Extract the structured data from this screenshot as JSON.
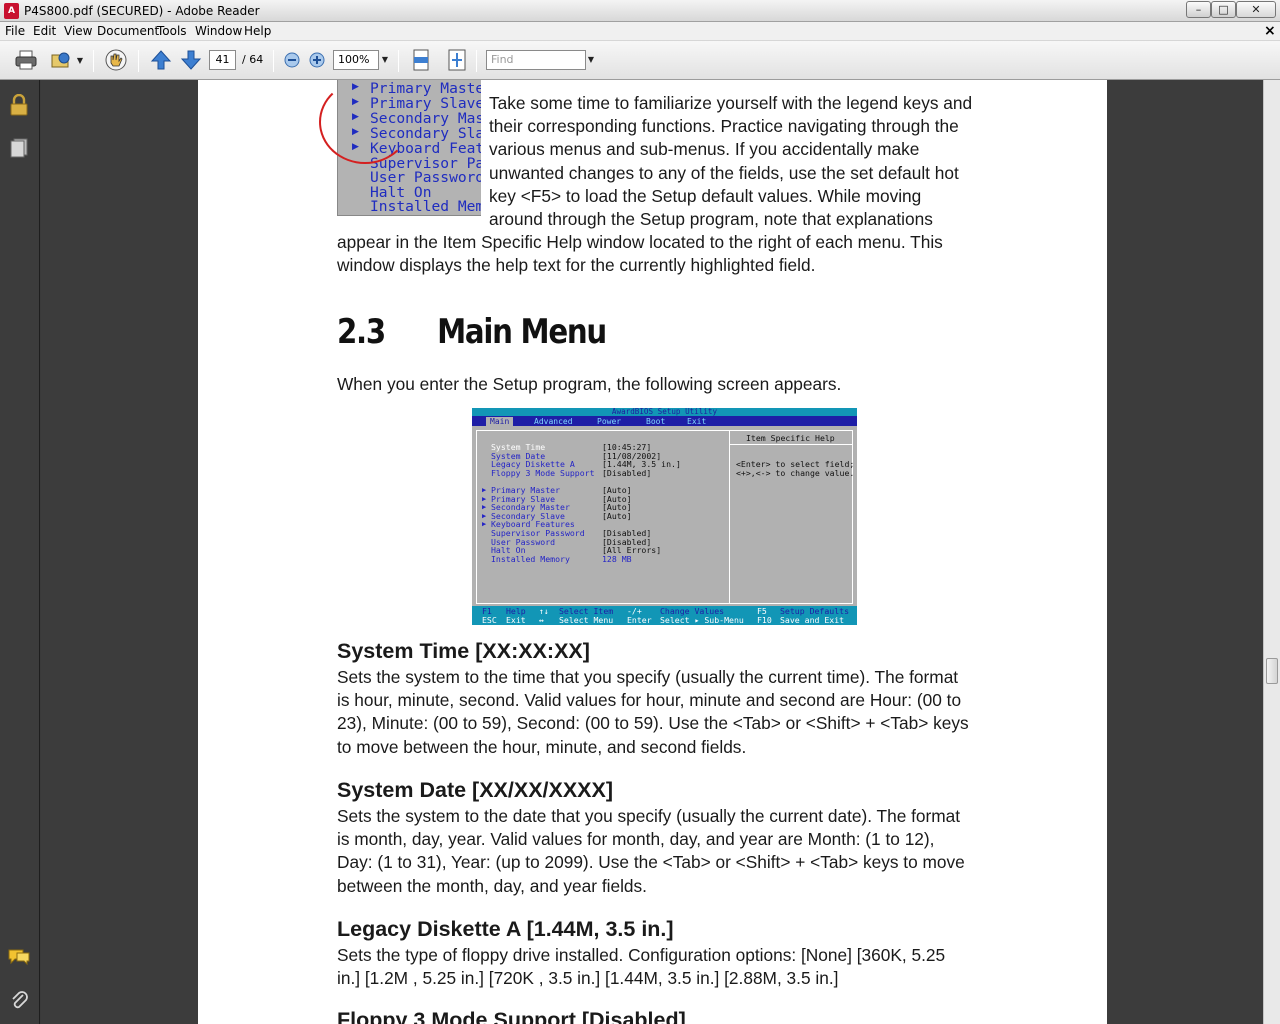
{
  "window": {
    "title": "P4S800.pdf (SECURED) - Adobe Reader",
    "app_icon": "A",
    "min": "–",
    "max": "□",
    "close": "✕"
  },
  "menubar": {
    "items": [
      "File",
      "Edit",
      "View",
      "Document",
      "Tools",
      "Window",
      "Help"
    ],
    "doc_close": "×"
  },
  "toolbar": {
    "page_current": "41",
    "page_total": "/ 64",
    "zoom": "100%",
    "find_placeholder": "Find"
  },
  "document": {
    "intro_paragraph_lines": [
      "Take some time to familiarize yourself with the legend keys and",
      "their corresponding functions. Practice navigating through the",
      "various menus and sub-menus. If you accidentally make",
      "unwanted changes to any of the fields, use the set default hot",
      "key <F5> to load the Setup default values. While moving",
      "around through the Setup program, note that explanations",
      "appear in the Item Specific Help window located to the right of each menu. This",
      "window displays the help text for the currently highlighted field."
    ],
    "crop_items": [
      "Primary Master",
      "Primary Slave",
      "Secondary Mast",
      "Secondary Slav",
      "Keyboard Featu",
      "Supervisor Pas",
      "User Password",
      "Halt On",
      "Installed Memo"
    ],
    "section_number": "2.3",
    "section_title": "Main Menu",
    "section_intro": "When you enter the Setup program, the following screen appears.",
    "bios": {
      "title": "AwardBIOS Setup Utility",
      "tabs": [
        "Main",
        "Advanced",
        "Power",
        "Boot",
        "Exit"
      ],
      "help_title": "Item Specific Help",
      "help_lines": [
        "<Enter> to select field;",
        "<+>,<-> to change value."
      ],
      "rows": [
        {
          "label": "System Time",
          "value": "[10:45:27]"
        },
        {
          "label": "System Date",
          "value": "[11/08/2002]"
        },
        {
          "label": "Legacy Diskette A",
          "value": "[1.44M, 3.5 in.]"
        },
        {
          "label": "Floppy 3 Mode Support",
          "value": "[Disabled]"
        },
        {
          "label": "Primary Master",
          "value": "[Auto]"
        },
        {
          "label": "Primary Slave",
          "value": "[Auto]"
        },
        {
          "label": "Secondary Master",
          "value": "[Auto]"
        },
        {
          "label": "Secondary Slave",
          "value": "[Auto]"
        },
        {
          "label": "Keyboard Features",
          "value": ""
        },
        {
          "label": "Supervisor Password",
          "value": "[Disabled]"
        },
        {
          "label": "User Password",
          "value": "[Disabled]"
        },
        {
          "label": "Halt On",
          "value": "[All Errors]"
        },
        {
          "label": "Installed Memory",
          "value": "128 MB"
        }
      ],
      "footer_row1": [
        "F1",
        "Help",
        "↑↓",
        "Select Item",
        "-/+",
        "Change Values",
        "F5",
        "Setup Defaults"
      ],
      "footer_row2": [
        "ESC",
        "Exit",
        "↔",
        "Select Menu",
        "Enter",
        "Select ▸ Sub-Menu",
        "F10",
        "Save and Exit"
      ]
    },
    "sections": [
      {
        "heading": "System Time [XX:XX:XX]",
        "lines": [
          "Sets the system to the time that you specify (usually the current time). The format",
          "is hour, minute, second. Valid values for hour, minute and second are Hour: (00 to",
          "23), Minute: (00 to 59), Second: (00 to 59). Use the <Tab> or <Shift> + <Tab> keys",
          "to move between the hour, minute, and second fields."
        ]
      },
      {
        "heading": "System Date [XX/XX/XXXX]",
        "lines": [
          "Sets the system to the date that you specify (usually the current date). The format",
          "is month, day, year. Valid values for month, day, and year are Month: (1 to 12),",
          "Day: (1 to 31), Year: (up to 2099). Use the <Tab> or <Shift> + <Tab> keys to move",
          "between the month, day, and year fields."
        ]
      },
      {
        "heading": "Legacy Diskette A [1.44M, 3.5 in.]",
        "lines": [
          "Sets the type of floppy drive installed. Configuration options: [None] [360K, 5.25",
          "in.] [1.2M , 5.25 in.] [720K , 3.5 in.] [1.44M, 3.5 in.] [2.88M, 3.5 in.]"
        ]
      },
      {
        "heading": "Floppy 3 Mode Support [Disabled]",
        "lines": []
      }
    ]
  }
}
